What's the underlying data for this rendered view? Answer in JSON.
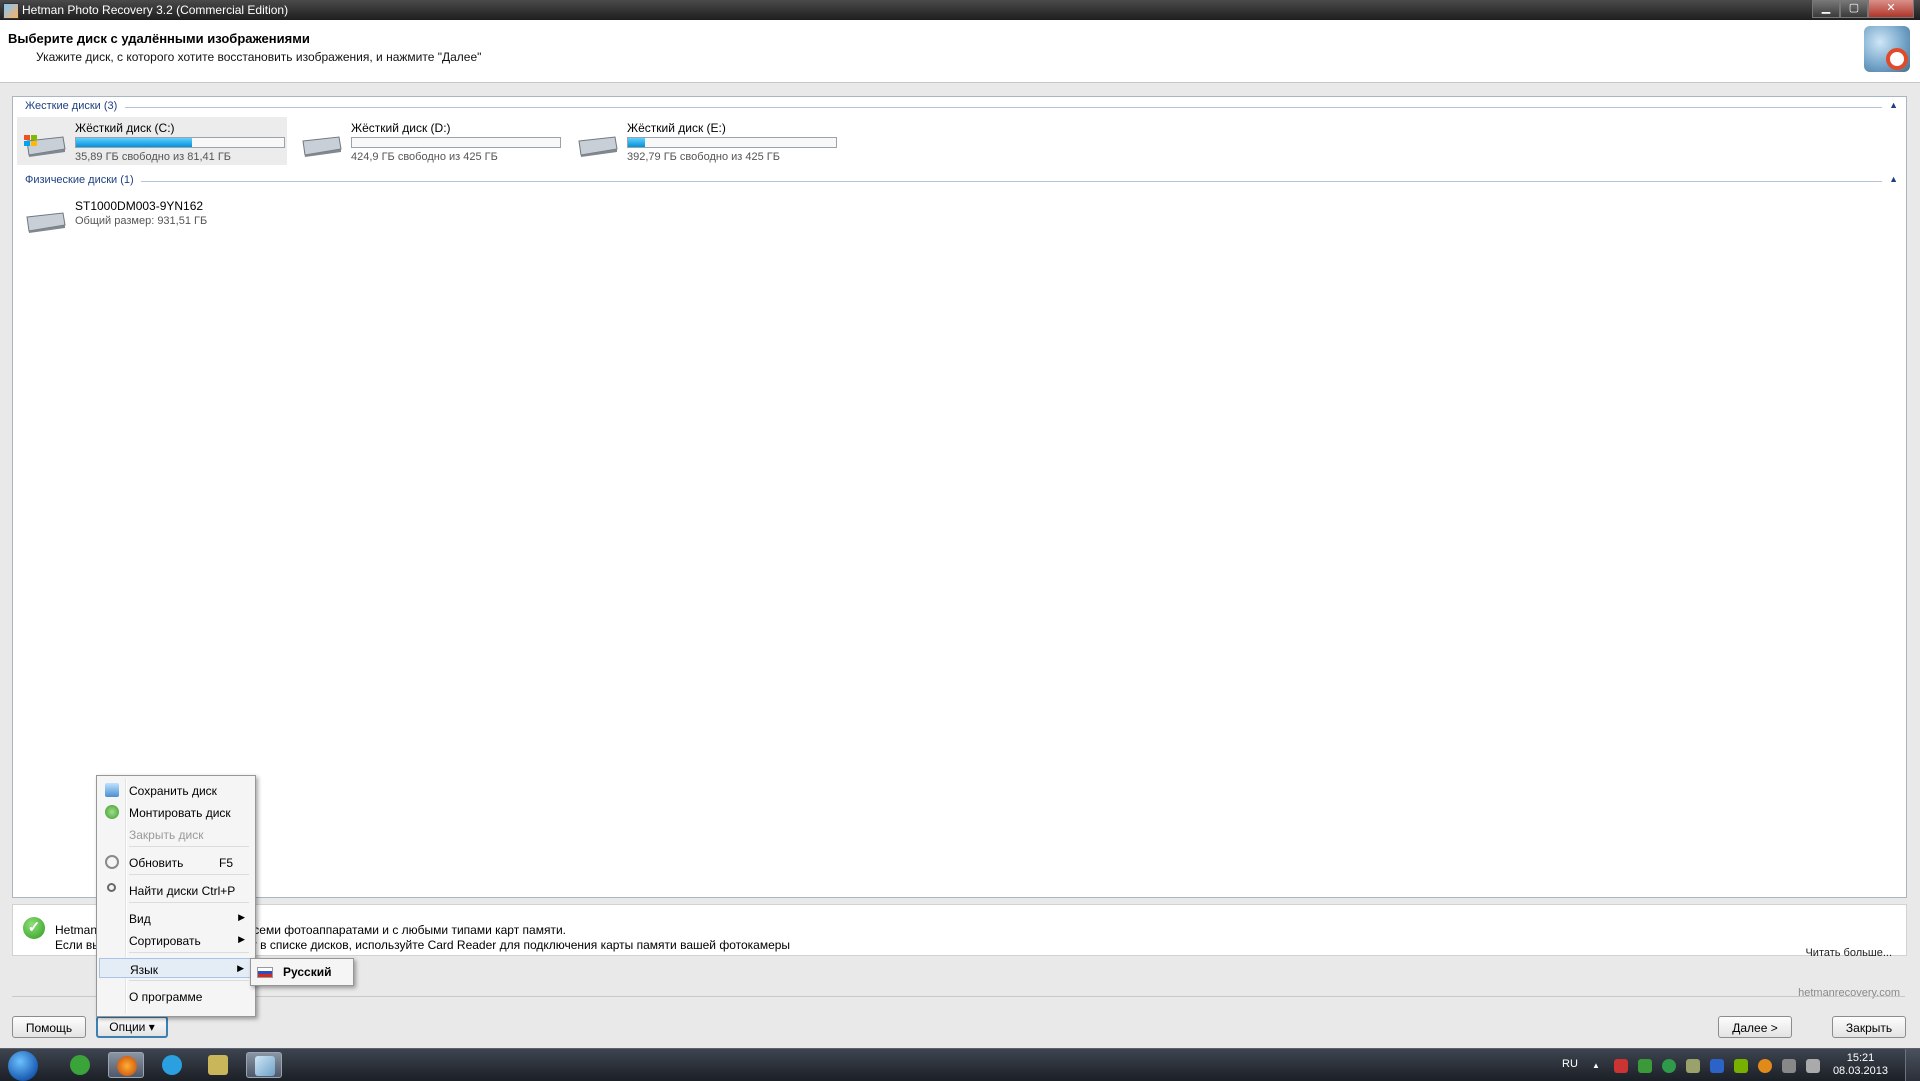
{
  "window": {
    "title": "Hetman Photo Recovery 3.2 (Commercial Edition)",
    "controls": [
      "minimize-icon",
      "maximize-icon",
      "close-icon"
    ]
  },
  "header": {
    "title": "Выберите диск с удалёнными изображениями",
    "subtitle": "Укажите диск, с которого хотите восстановить изображения, и нажмите \"Далее\""
  },
  "hard_disks": {
    "label": "Жесткие диски (3)",
    "items": [
      {
        "name": "Жёсткий диск (C:)",
        "info": "35,89 ГБ свободно из 81,41 ГБ",
        "used_fraction": 0.56,
        "system": true
      },
      {
        "name": "Жёсткий диск (D:)",
        "info": "424,9 ГБ свободно из 425 ГБ",
        "used_fraction": 0.0
      },
      {
        "name": "Жёсткий диск (E:)",
        "info": "392,79 ГБ свободно из 425 ГБ",
        "used_fraction": 0.08
      }
    ]
  },
  "physical_disks": {
    "label": "Физические диски (1)",
    "items": [
      {
        "name": "ST1000DM003-9YN162",
        "info": "Общий размер: 931,51 ГБ"
      }
    ]
  },
  "info": {
    "line1_left": "Hetman",
    "line1_right": "всеми фотоаппаратами и с любыми типами карт памяти.",
    "line2_left": "Если вы",
    "line2_right": "ат в списке дисков, используйте Card Reader для подключения карты памяти вашей фотокамеры",
    "read_more": "Читать больше..."
  },
  "site": "hetmanrecovery.com",
  "buttons": {
    "help": "Помощь",
    "options": "Опции ▾",
    "next": "Далее >",
    "close": "Закрыть"
  },
  "menu": {
    "items": [
      {
        "label": "Сохранить диск",
        "icon": "save-disk-icon",
        "enabled": true
      },
      {
        "label": "Монтировать диск",
        "icon": "mount-disk-icon",
        "enabled": true
      },
      {
        "label": "Закрыть диск",
        "enabled": false
      },
      {
        "label": "Обновить",
        "shortcut": "F5",
        "icon": "refresh-icon",
        "enabled": true
      },
      {
        "label": "Найти диски",
        "shortcut": "Ctrl+P",
        "icon": "find-disks-icon",
        "enabled": true
      },
      {
        "label": "Вид",
        "submenu": true,
        "enabled": true
      },
      {
        "label": "Сортировать",
        "submenu": true,
        "enabled": true
      },
      {
        "label": "Язык",
        "submenu": true,
        "enabled": true,
        "highlighted": true
      },
      {
        "label": "О программе",
        "enabled": true
      }
    ],
    "language_submenu": {
      "label": "Русский",
      "icon": "russian-flag-icon"
    }
  },
  "taskbar": {
    "lang": "RU",
    "time": "15:21",
    "date": "08.03.2013",
    "tray_up_arrow": "▲"
  },
  "colors": {
    "accent_blue": "#0690d6",
    "group_header": "#1e3f82",
    "check_green": "#2e9a1c"
  }
}
